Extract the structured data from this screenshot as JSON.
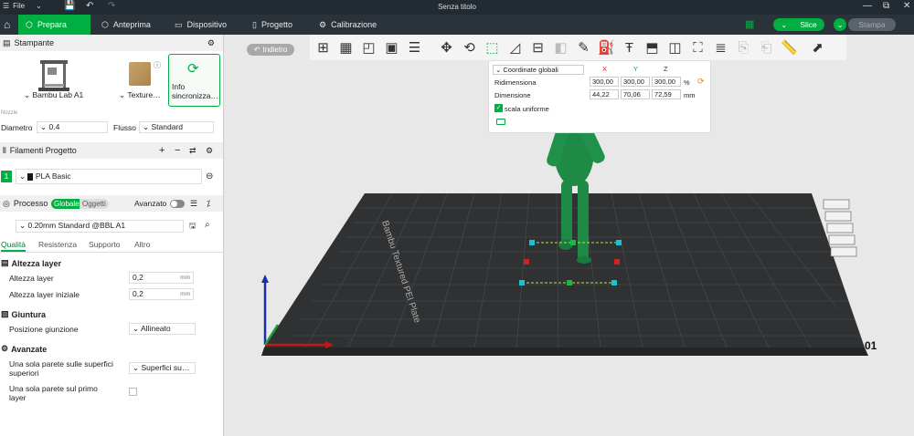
{
  "titlebar": {
    "menu_label": "File",
    "title": "Senza titolo"
  },
  "tabs": [
    {
      "label": "Prepara"
    },
    {
      "label": "Anteprima"
    },
    {
      "label": "Dispositivo"
    },
    {
      "label": "Progetto"
    },
    {
      "label": "Calibrazione"
    }
  ],
  "actions": {
    "slice": "Slice",
    "print": "Stampa"
  },
  "printer": {
    "section": "Stampante",
    "printer_name": "Bambu Lab A1",
    "plate_label": "Texture…",
    "sync_label": "Info sincronizza…",
    "nozzle_label": "Nozzle",
    "diameter_label": "Diametro",
    "diameter_value": "0.4",
    "flow_label": "Flusso",
    "flow_value": "Standard"
  },
  "filament": {
    "section": "Filamenti Progetto",
    "slot_number": "1",
    "name": "PLA Basic",
    "color": "#1a1a1a"
  },
  "process": {
    "section": "Processo",
    "scope_global": "Globale",
    "scope_objects": "Oggetti",
    "advanced_label": "Avanzato",
    "profile": "0.20mm Standard @BBL A1",
    "tabs": [
      "Qualità",
      "Resistenza",
      "Supporto",
      "Altro"
    ],
    "groups": {
      "layer_height": "Altezza layer",
      "seam": "Giuntura",
      "advanced": "Avanzate"
    },
    "fields": {
      "layer_height_label": "Altezza layer",
      "layer_height_value": "0,2",
      "first_layer_label": "Altezza layer iniziale",
      "first_layer_value": "0,2",
      "unit": "mm",
      "seam_pos_label": "Posizione giunzione",
      "seam_pos_value": "Allineato",
      "single_wall_top_label": "Una sola parete sulle superfici superiori",
      "single_wall_top_value": "Superfici su…",
      "single_wall_first_label": "Una sola parete sul primo layer"
    }
  },
  "viewport": {
    "back_label": "Indietro",
    "plate_brand": "Bambu Textured PEI Plate",
    "plate_number": "01"
  },
  "scale_panel": {
    "coord_label": "Coordinate globali",
    "axis_x": "X",
    "axis_y": "Y",
    "axis_z": "Z",
    "scale_label": "Ridimensiona",
    "scale_x": "300,00",
    "scale_y": "300,00",
    "scale_z": "300,00",
    "scale_unit": "%",
    "size_label": "Dimensione",
    "size_x": "44,22",
    "size_y": "70,06",
    "size_z": "72,59",
    "size_unit": "mm",
    "uniform_label": "scala uniforme"
  },
  "colors": {
    "accent": "#00ae42",
    "model": "#1e8a45",
    "plate": "#2f3133",
    "titlebar": "#232b32"
  }
}
